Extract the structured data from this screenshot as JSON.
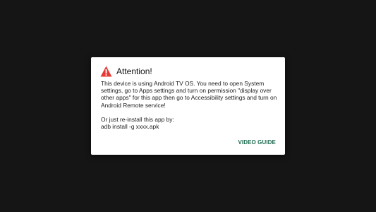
{
  "dialog": {
    "icon": "warning-icon",
    "title": "Attention!",
    "message_paragraph_1": "This device is using Android TV OS. You need to open System settings, go to Apps settings and turn on permission \"display over other apps\" for this app then go to Accessibility settings and turn on Android Remote service!",
    "message_paragraph_2_line_1": "Or just re-install this app by:",
    "message_paragraph_2_line_2": "adb install -g xxxx.apk",
    "action_button_label": "VIDEO GUIDE"
  },
  "colors": {
    "background": "#151515",
    "dialog_background": "#ffffff",
    "warning_red": "#e53935",
    "accent": "#1e6b4f"
  }
}
